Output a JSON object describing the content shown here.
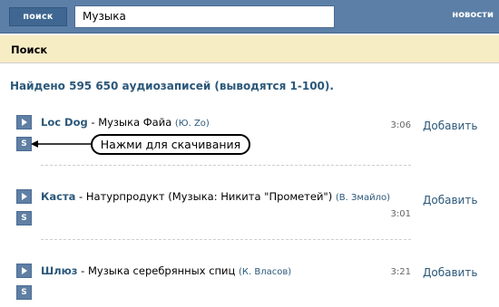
{
  "header": {
    "search_button": "поиск",
    "search_value": "Музыка",
    "news_link": "новости"
  },
  "section": {
    "title": "Поиск"
  },
  "results": {
    "count_text": "Найдено 595 650 аудиозаписей (выводятся 1-100)."
  },
  "tracks": [
    {
      "artist": "Loc Dog",
      "separator": " - ",
      "title": "Музыка Файа",
      "author": "(Ю. Zo)",
      "duration": "3:06",
      "add": "Добавить",
      "save_icon": "S"
    },
    {
      "artist": "Каста",
      "separator": " - ",
      "title": "Натурпродукт (Музыка: Никита \"Прометей\")",
      "author": "(В. Змайло)",
      "duration": "3:01",
      "add": "Добавить",
      "save_icon": "S"
    },
    {
      "artist": "Шлюз",
      "separator": " - ",
      "title": "Музыка серебрянных спиц",
      "author": "(К. Власов)",
      "duration": "3:21",
      "add": "Добавить",
      "save_icon": "S"
    }
  ],
  "annotation": {
    "text": "Нажми для скачивания"
  },
  "icons": {
    "play": "play-icon",
    "save": "save-icon"
  },
  "colors": {
    "topbar": "#5b7fa6",
    "header_bg": "#f7edc5",
    "link": "#2b587a"
  }
}
